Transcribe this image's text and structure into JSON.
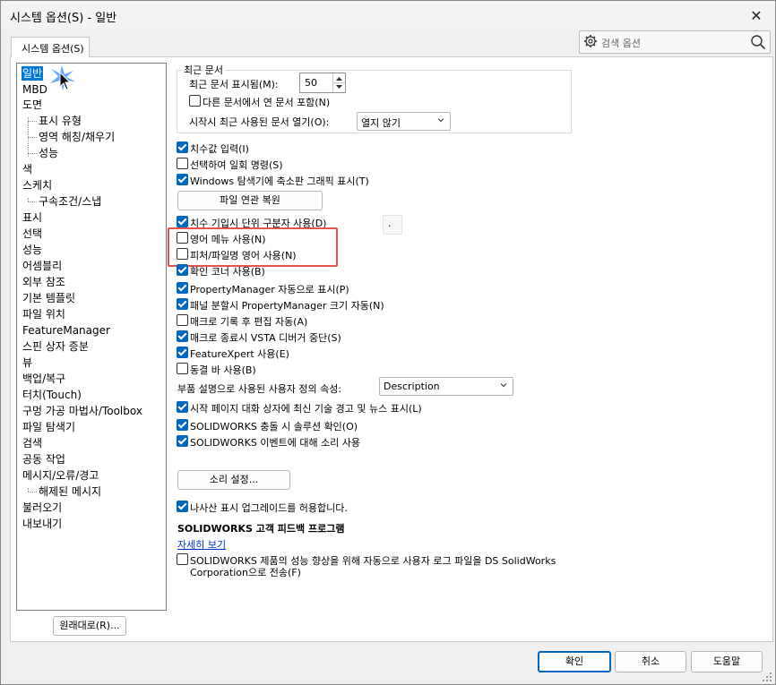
{
  "window": {
    "title": "시스템 옵션(S) - 일반",
    "close_glyph": "✕"
  },
  "tab": {
    "label": "시스템 옵션(S)"
  },
  "search": {
    "placeholder": "검색 옵션"
  },
  "tree": {
    "items": [
      {
        "label": "일반",
        "selected": true
      },
      {
        "label": "MBD"
      },
      {
        "label": "도면"
      },
      {
        "label": "표시 유형",
        "indent": 1
      },
      {
        "label": "영역 해칭/채우기",
        "indent": 1
      },
      {
        "label": "성능",
        "indent": 1
      },
      {
        "label": "색"
      },
      {
        "label": "스케치"
      },
      {
        "label": "구속조건/스냅",
        "indent": 1
      },
      {
        "label": "표시"
      },
      {
        "label": "선택"
      },
      {
        "label": "성능"
      },
      {
        "label": "어셈블리"
      },
      {
        "label": "외부 참조"
      },
      {
        "label": "기본 템플릿"
      },
      {
        "label": "파일 위치"
      },
      {
        "label": "FeatureManager"
      },
      {
        "label": "스핀 상자 증분"
      },
      {
        "label": "뷰"
      },
      {
        "label": "백업/복구"
      },
      {
        "label": "터치(Touch)"
      },
      {
        "label": "구멍 가공 마법사/Toolbox"
      },
      {
        "label": "파일 탐색기"
      },
      {
        "label": "검색"
      },
      {
        "label": "공동 작업"
      },
      {
        "label": "메시지/오류/경고"
      },
      {
        "label": "해제된 메시지",
        "indent": 1
      },
      {
        "label": "불러오기"
      },
      {
        "label": "내보내기"
      }
    ],
    "reset_button": "원래대로(R)..."
  },
  "recent": {
    "group_label": "최근 문서",
    "show_label": "최근 문서 표시됨(M):",
    "show_value": "50",
    "include_label": "다른 문서에서 연 문서 포함(N)",
    "open_label": "시작시 최근 사용된 문서 열기(O):",
    "open_value": "열지 않기"
  },
  "options1": [
    {
      "label": "치수값 입력(I)",
      "checked": true
    },
    {
      "label": "선택하여 일회 명령(S)",
      "checked": false
    },
    {
      "label": "Windows 탐색기에 축소판 그래픽 표시(T)",
      "checked": true
    }
  ],
  "restore_button": "파일 연관 복원",
  "options2": [
    {
      "label": "치수 기입시 단위 구분자 사용(D)",
      "checked": true
    },
    {
      "label": "영어 메뉴 사용(N)",
      "checked": false
    },
    {
      "label": "피처/파일명 영어 사용(N)",
      "checked": false
    },
    {
      "label": "확인 코너 사용(B)",
      "checked": true
    },
    {
      "label": "PropertyManager 자동으로 표시(P)",
      "checked": true
    },
    {
      "label": "패널 분할시 PropertyManager 크기 자동(N)",
      "checked": true
    },
    {
      "label": "매크로 기록 후 편집 자동(A)",
      "checked": false
    },
    {
      "label": "매크로 종료시 VSTA 디버거 중단(S)",
      "checked": true
    },
    {
      "label": "FeatureXpert 사용(E)",
      "checked": true
    },
    {
      "label": "동결 바 사용(B)",
      "checked": false
    }
  ],
  "separator_value": ".",
  "part_desc": {
    "label": "부품 설명으로 사용된 사용자 정의 속성:",
    "value": "Description"
  },
  "options3": [
    {
      "label": "시작 페이지 대화 상자에 최신 기술 경고 및 뉴스 표시(L)",
      "checked": true
    },
    {
      "label": "SOLIDWORKS 충돌 시 솔루션 확인(O)",
      "checked": true
    },
    {
      "label": "SOLIDWORKS 이벤트에 대해 소리 사용",
      "checked": true
    }
  ],
  "sound_button": "소리 설정...",
  "upgrade": {
    "label": "나사산 표시 업그레이드를 허용합니다.",
    "checked": true
  },
  "feedback": {
    "heading": "SOLIDWORKS 고객 피드백 프로그램",
    "link": "자세히 보기",
    "label_line1": "SOLIDWORKS 제품의 성능 향상을 위해 자동으로 사용자 로그 파일을 DS SolidWorks",
    "label_line2": "Corporation으로 전송(F)",
    "checked": false
  },
  "footer": {
    "ok": "확인",
    "cancel": "취소",
    "help": "도움말"
  },
  "colors": {
    "accent": "#0067c0",
    "selection": "#0078d7",
    "highlight_box": "#e5534b"
  }
}
